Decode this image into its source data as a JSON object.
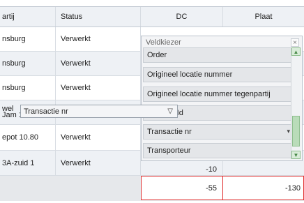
{
  "table": {
    "columns": {
      "partij": "artij",
      "status": "Status",
      "dc": "DC",
      "plaat": "Plaat"
    },
    "rows": [
      {
        "partij": "nsburg",
        "status": "Verwerkt"
      },
      {
        "partij": "nsburg",
        "status": "Verwerkt"
      },
      {
        "partij": "nsburg",
        "status": "Verwerkt"
      },
      {
        "partij": "wel",
        "partij2": "Jam 14",
        "status": ""
      },
      {
        "partij": "epot 10.80",
        "status": "Verwerkt"
      },
      {
        "partij": "3A-zuid 1",
        "status": "Verwerkt",
        "dc": "-10"
      }
    ],
    "totals": {
      "dc": "-55",
      "plaat": "-130"
    }
  },
  "veldkiezer": {
    "title": "Veldkiezer",
    "close": "×",
    "items": [
      "Order",
      "Origineel locatie nummer",
      "Origineel locatie nummer tegenpartij",
      "tie Id",
      "Transactie nr",
      "Transporteur"
    ]
  },
  "drag_field": {
    "label": "Transactie nr",
    "arrow": "▽"
  }
}
